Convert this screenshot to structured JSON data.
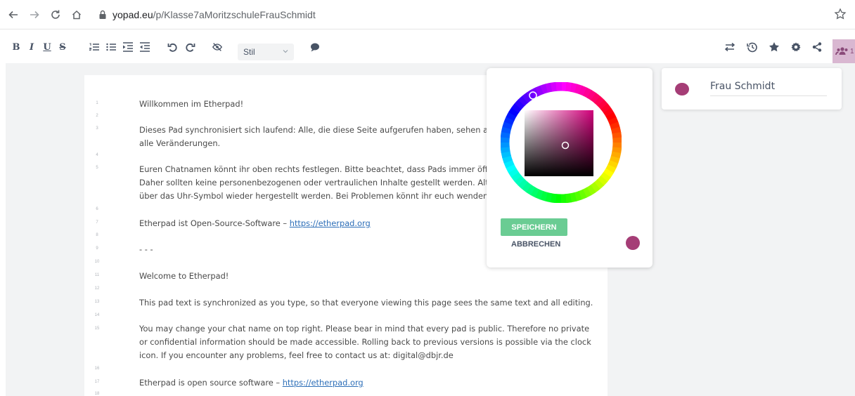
{
  "browser": {
    "url_host": "yopad.eu",
    "url_path": "/p/Klasse7aMoritzschuleFrauSchmidt",
    "icons": [
      "back-arrow-icon",
      "forward-arrow-icon",
      "reload-icon",
      "home-icon",
      "lock-icon",
      "bookmark-star-icon"
    ]
  },
  "toolbar": {
    "bold": "B",
    "italic": "I",
    "underline": "U",
    "strike": "S",
    "style_select": "Stil",
    "left_icons": [
      "ordered-list-icon",
      "unordered-list-icon",
      "indent-icon",
      "outdent-icon",
      "undo-icon",
      "redo-icon",
      "hide-authorship-icon",
      "comment-icon"
    ],
    "right_icons": [
      "import-export-icon",
      "timeslider-icon",
      "star-icon",
      "settings-icon",
      "share-icon",
      "users-icon"
    ],
    "users_count": "1"
  },
  "editor": {
    "lines": [
      {
        "num": "1",
        "text": "Willkommen im Etherpad!"
      },
      {
        "num": "2",
        "text": ""
      },
      {
        "num": "3",
        "text": "Dieses Pad synchronisiert sich laufend: Alle, die diese Seite aufgerufen haben, sehen auch",
        "text2": "alle Veränderungen."
      },
      {
        "num": "4",
        "text": ""
      },
      {
        "num": "5",
        "text": "Euren Chatnamen könnt ihr oben rechts festlegen. Bitte beachtet, dass Pads immer öffent",
        "text2": "Daher sollten keine personenbezogenen oder vertraulichen Inhalte gestellt werden. Alte",
        "text3": "über das Uhr-Symbol wieder hergestellt werden. Bei Problemen könnt ihr euch wenden an"
      },
      {
        "num": "6",
        "text": ""
      },
      {
        "num": "7",
        "text": "Etherpad ist Open-Source-Software – ",
        "link": "https://etherpad.org"
      },
      {
        "num": "8",
        "text": ""
      },
      {
        "num": "9",
        "text": "- - -"
      },
      {
        "num": "10",
        "text": ""
      },
      {
        "num": "11",
        "text": "Welcome to Etherpad!"
      },
      {
        "num": "12",
        "text": ""
      },
      {
        "num": "13",
        "text": "This pad text is synchronized as you type, so that everyone viewing this page sees the same text and all editing."
      },
      {
        "num": "14",
        "text": ""
      },
      {
        "num": "15",
        "text": "You may change your chat name on top right. Please bear in mind that every pad is public. Therefore no private",
        "text2": "or confidential information should be made accessible. Rolling back to previous versions is possible via the clock",
        "text3": "icon. If you encounter any problems, feel free to contact us at: digital@dbjr.de"
      },
      {
        "num": "16",
        "text": ""
      },
      {
        "num": "17",
        "text": "Etherpad is open source software – ",
        "link": "https://etherpad.org"
      },
      {
        "num": "18",
        "text": ""
      }
    ]
  },
  "color_picker": {
    "save_label": "SPEICHERN",
    "cancel_label": "ABBRECHEN",
    "selected_color": "#a53d76",
    "hue_color": "#d1007a"
  },
  "users": {
    "list": [
      {
        "name": "Frau Schmidt",
        "color": "#a53d76"
      }
    ]
  },
  "colors": {
    "accent_green": "#6acc93",
    "toolbar_icon": "#485365",
    "link": "#2e6fb8"
  }
}
